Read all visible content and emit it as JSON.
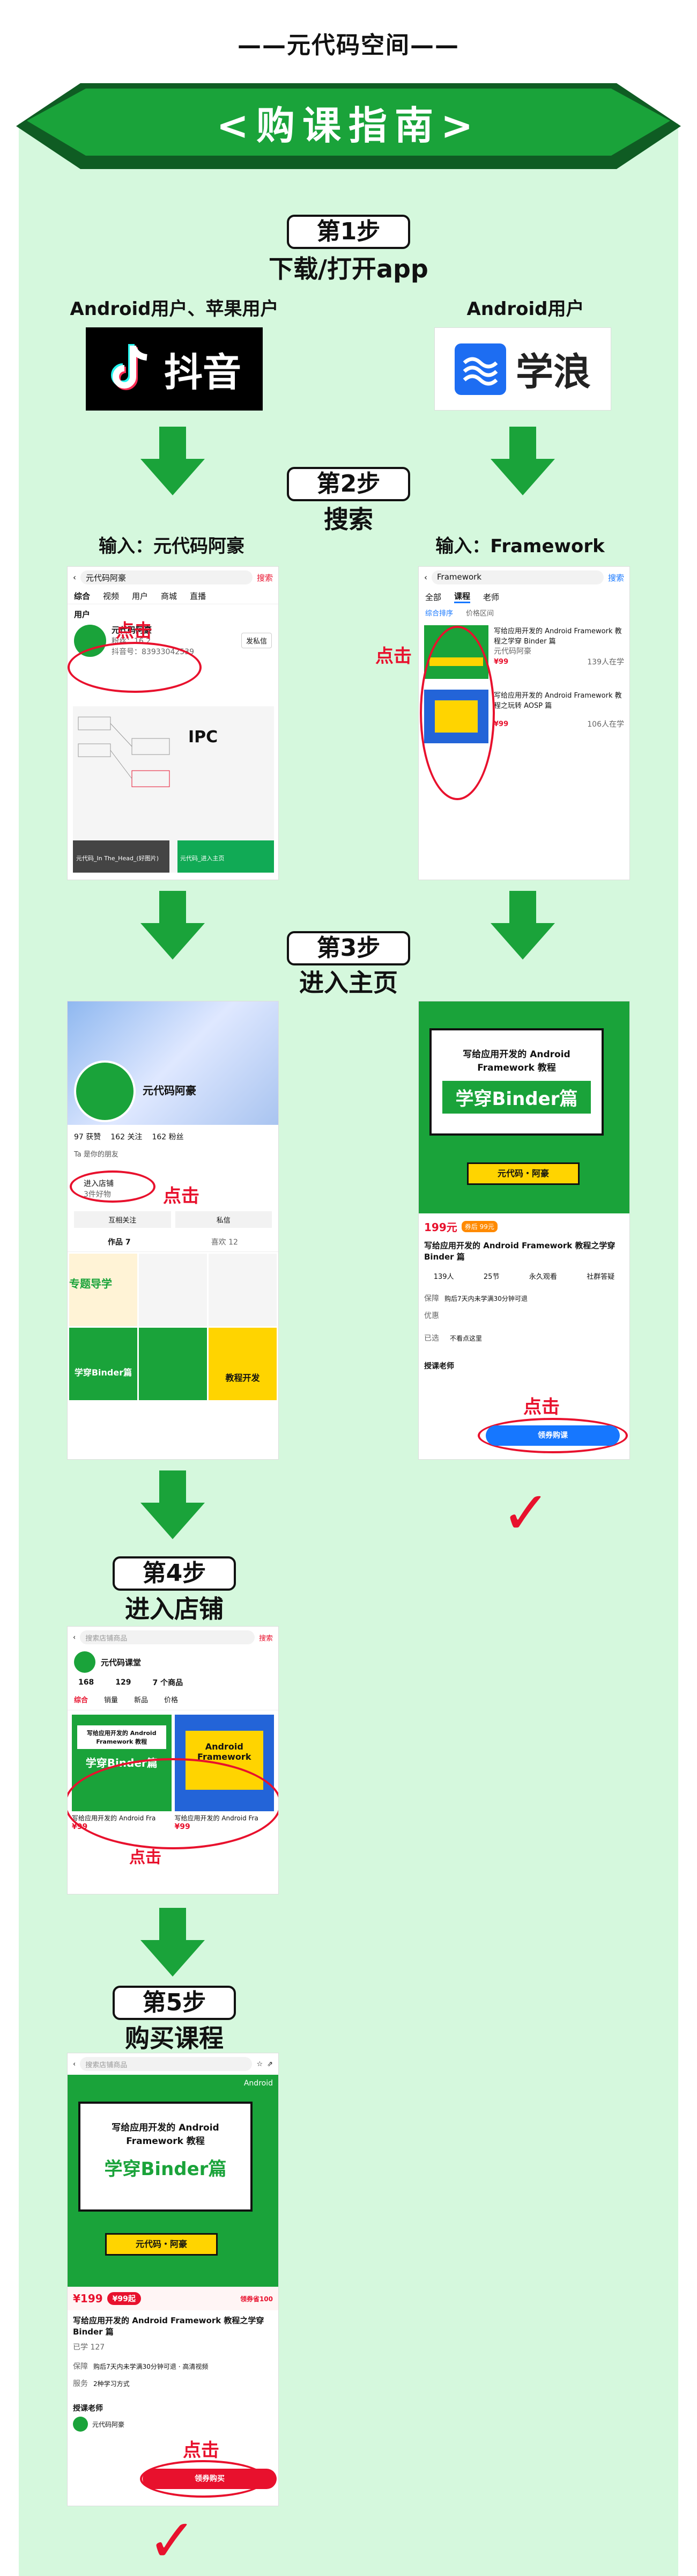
{
  "header": {
    "brand": "——元代码空间——",
    "banner": "<购课指南>"
  },
  "colors": {
    "green": "#1aa33a",
    "dark_green": "#0f5c23",
    "panel": "#d5f8dd",
    "red": "#e8112d",
    "blue": "#1677ff"
  },
  "step1": {
    "step": "第1步",
    "title": "下载/打开app",
    "left_label": "Android用户、苹果用户",
    "right_label": "Android用户",
    "left_app": "抖音",
    "right_app": "学浪"
  },
  "step2": {
    "step": "第2步",
    "title": "搜索",
    "left_input": "输入：元代码阿豪",
    "right_input": "输入：Framework",
    "left_shot": {
      "search": "元代码阿豪",
      "search_btn": "搜索",
      "tabs": [
        "综合",
        "视频",
        "用户",
        "商城",
        "直播"
      ],
      "section": "用户",
      "user": "元代码阿豪",
      "fans": "粉丝：16.2",
      "id": "抖音号：83933042539",
      "follow": "发私信",
      "click": "点击",
      "video1": "元代码_In The_Head_(好图片)",
      "video2": "元代码_进入主页",
      "ipc": "IPC"
    },
    "right_shot": {
      "search": "Framework",
      "search_btn": "搜索",
      "tabs": [
        "全部",
        "课程",
        "老师"
      ],
      "filters": [
        "综合排序",
        "价格区间"
      ],
      "course1": "写给应用开发的 Android Framework 教程之学穿 Binder 篇",
      "course1_meta": "元代码阿豪",
      "course1_price": "¥99",
      "course1_count": "139人在学",
      "course2": "写给应用开发的 Android Framework 教程之玩转 AOSP 篇",
      "course2_price": "¥99",
      "course2_count": "106人在学",
      "click": "点击"
    }
  },
  "step3": {
    "step": "第3步",
    "title": "进入主页",
    "left_shot": {
      "name": "元代码阿豪",
      "stats": [
        "97 获赞",
        "162 关注",
        "162 粉丝"
      ],
      "fans_note": "Ta 是你的朋友",
      "shop": "进入店铺",
      "shop_sub": "3件好物",
      "click": "点击",
      "btns": [
        "互相关注",
        "私信"
      ],
      "tabs": [
        "作品 7",
        "喜欢 12"
      ],
      "card1": "专题导学",
      "card2": "学穿Binder篇",
      "card3": "教程开发"
    },
    "right_shot": {
      "card_title": "写给应用开发的 Android Framework 教程",
      "card_big": "学穿Binder篇",
      "card_author": "元代码・阿豪",
      "price": "199元",
      "promo": "券后 99元",
      "course": "写给应用开发的 Android Framework 教程之学穿 Binder 篇",
      "stats": [
        "139人",
        "25节",
        "永久观看",
        "社群答疑"
      ],
      "guarantee": "保障",
      "guarantee_text": "购后7天内未学满30分钟可退",
      "offer": "优惠",
      "learned": "已选",
      "learned_text": "不看点这里",
      "teacher": "授课老师",
      "click": "点击",
      "buy": "领券购课"
    },
    "check": "✓"
  },
  "step4": {
    "step": "第4步",
    "title": "进入店铺",
    "shot": {
      "search": "搜索店铺商品",
      "search_btn": "搜索",
      "shop": "元代码课堂",
      "stats": [
        "168",
        "129",
        "7 个商品"
      ],
      "tabs": [
        "综合",
        "销量",
        "新品",
        "价格"
      ],
      "p1_title": "写给应用开发的 Android Framework 教程",
      "p1_big": "学穿Binder篇",
      "p2_title": "Android Framework",
      "p1_name": "写给应用开发的 Android Fra",
      "p2_name": "写给应用开发的 Android Fra",
      "p1_price": "¥99",
      "p2_price": "¥99",
      "click": "点击"
    }
  },
  "step5": {
    "step": "第5步",
    "title": "购买课程",
    "shot": {
      "search": "搜索店铺商品",
      "card_title": "写给应用开发的 Android Framework 教程",
      "card_big": "学穿Binder篇",
      "card_author": "元代码・阿豪",
      "corner": "Android",
      "price": "¥199",
      "promo": "¥99起",
      "coupon": "领券省100",
      "course": "写给应用开发的 Android Framework 教程之学穿 Binder 篇",
      "learners": "已学 127",
      "guarantee": "保障",
      "guarantee_text": "购后7天内未学满30分钟可退 · 高清视频",
      "service": "服务",
      "service_text": "2种学习方式",
      "teacher": "授课老师",
      "teacher_name": "元代码阿豪",
      "click": "点击",
      "buy": "领券购买"
    },
    "check": "✓"
  }
}
